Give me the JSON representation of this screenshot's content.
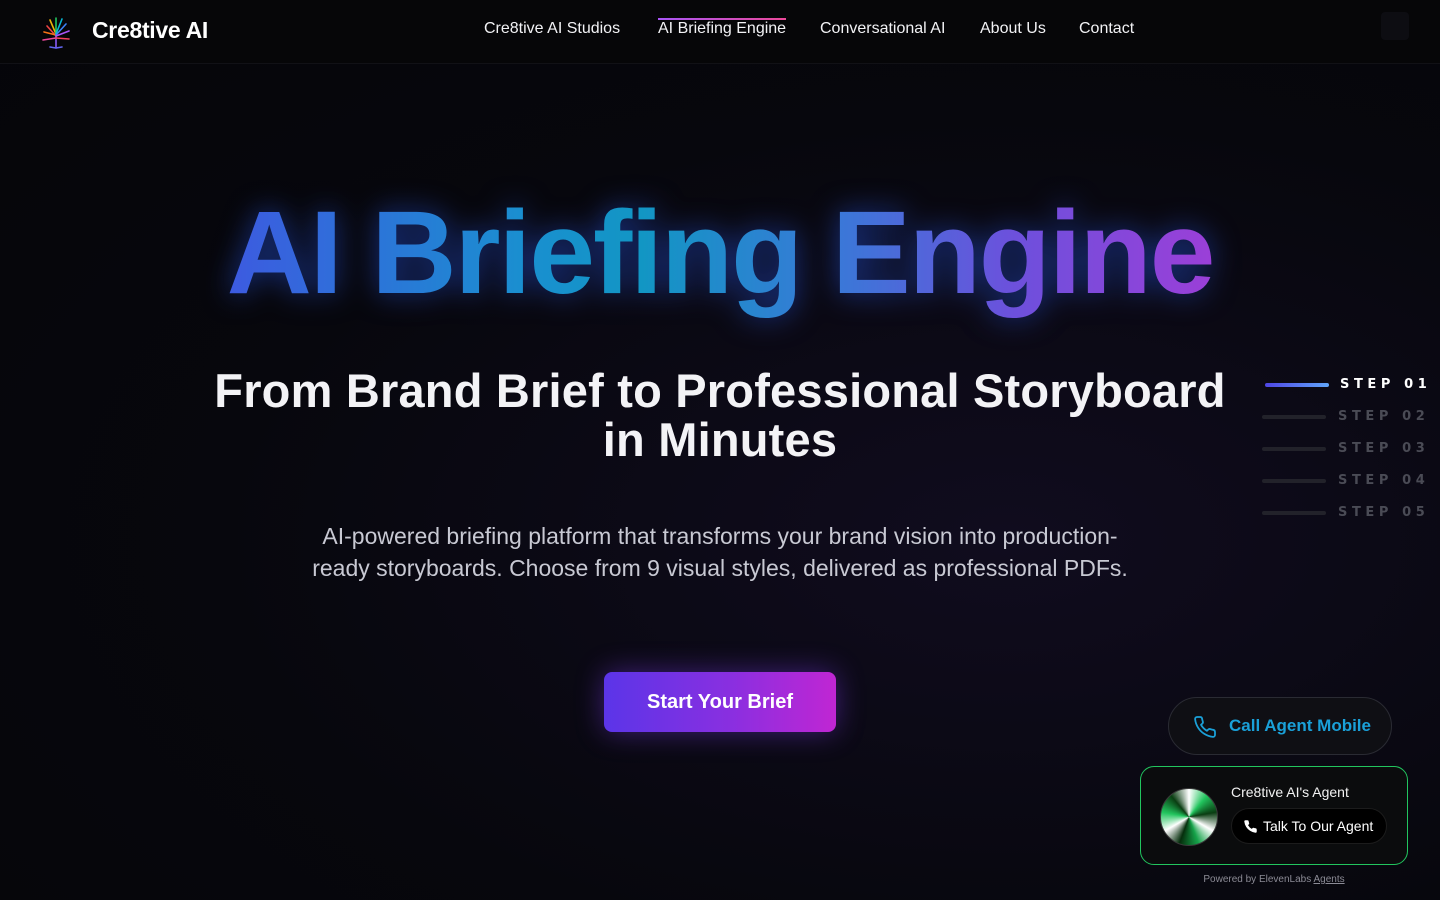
{
  "brand": {
    "name": "Cre8tive AI",
    "logo_icon": "tree-logo-icon"
  },
  "nav": {
    "links": [
      {
        "label": "Cre8tive AI Studios",
        "active": false
      },
      {
        "label": "AI Briefing Engine",
        "active": true
      },
      {
        "label": "Conversational AI",
        "active": false
      },
      {
        "label": "About Us",
        "active": false
      },
      {
        "label": "Contact",
        "active": false
      }
    ],
    "active_underline_colors": [
      "#a855f7",
      "#ec4899"
    ]
  },
  "hero": {
    "title": "AI Briefing Engine",
    "subtitle": "From Brand Brief to Professional Storyboard in Minutes",
    "description": "AI-powered briefing platform that transforms your brand vision into production-ready storyboards. Choose from 9 visual styles, delivered as professional PDFs.",
    "cta_label": "Start Your Brief",
    "title_gradient": [
      "#3d5ae0",
      "#1296c4",
      "#9b3fd8"
    ]
  },
  "steps": {
    "items": [
      "STEP 01",
      "STEP 02",
      "STEP 03",
      "STEP 04",
      "STEP 05"
    ],
    "active_index": 0
  },
  "call_widget": {
    "label": "Call Agent Mobile",
    "icon": "phone-icon",
    "color": "#1aa0d8"
  },
  "agent_widget": {
    "name": "Cre8tive AI's Agent",
    "button_label": "Talk To Our Agent",
    "button_icon": "phone-icon",
    "powered_prefix": "Powered by ElevenLabs",
    "powered_link": "Agents",
    "border_color": "#22c55e"
  }
}
